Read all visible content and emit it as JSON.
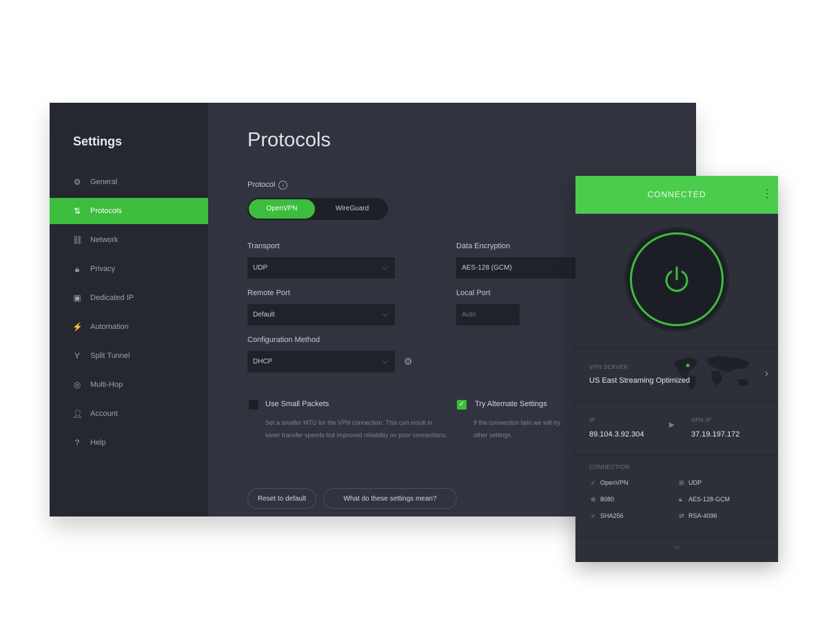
{
  "sidebar": {
    "title": "Settings",
    "items": [
      {
        "label": "General",
        "icon": "settings-icon"
      },
      {
        "label": "Protocols",
        "icon": "protocol-icon",
        "active": true
      },
      {
        "label": "Network",
        "icon": "network-icon"
      },
      {
        "label": "Privacy",
        "icon": "lock-icon"
      },
      {
        "label": "Dedicated IP",
        "icon": "dedicated-ip-icon"
      },
      {
        "label": "Automation",
        "icon": "automation-icon"
      },
      {
        "label": "Split Tunnel",
        "icon": "split-tunnel-icon"
      },
      {
        "label": "Multi-Hop",
        "icon": "multihop-icon"
      },
      {
        "label": "Account",
        "icon": "account-icon"
      },
      {
        "label": "Help",
        "icon": "help-icon"
      }
    ]
  },
  "main": {
    "title": "Protocols",
    "protocol": {
      "label": "Protocol",
      "options": [
        "OpenVPN",
        "WireGuard"
      ],
      "selected": "OpenVPN"
    },
    "transport": {
      "label": "Transport",
      "value": "UDP"
    },
    "data_encryption": {
      "label": "Data Encryption",
      "value": "AES-128 (GCM)"
    },
    "remote_port": {
      "label": "Remote Port",
      "value": "Default"
    },
    "local_port": {
      "label": "Local Port",
      "placeholder": "Auto"
    },
    "configuration_method": {
      "label": "Configuration Method",
      "value": "DHCP"
    },
    "small_packets": {
      "label": "Use Small Packets",
      "checked": false,
      "description": "Set a smaller MTU for the VPN connection. This can result in lower transfer speeds but improved reliability on poor connections."
    },
    "alternate_settings": {
      "label": "Try Alternate Settings",
      "checked": true,
      "description": "If the connection fails we will try other settings."
    },
    "buttons": {
      "reset": "Reset to default",
      "more": "What do these settings mean?"
    }
  },
  "widget": {
    "status": "CONNECTED",
    "location_label": "VPN SERVER",
    "location_name": "US East Streaming Optimized",
    "ip_label": "IP",
    "ip_value": "89.104.3.92.304",
    "vpn_ip_label": "VPN IP",
    "vpn_ip_value": "37.19.197.172",
    "connection_label": "CONNECTION",
    "connection_items": [
      {
        "icon": "protocol-icon",
        "text": "OpenVPN"
      },
      {
        "icon": "transport-icon",
        "text": "UDP"
      },
      {
        "icon": "port-icon",
        "text": "8080"
      },
      {
        "icon": "encryption-icon",
        "text": "AES-128-GCM"
      },
      {
        "icon": "auth-icon",
        "text": "SHA256"
      },
      {
        "icon": "handshake-icon",
        "text": "RSA-4096"
      }
    ],
    "accent": "#4ccc4c"
  },
  "colors": {
    "accent": "#3dbd3d",
    "sidebar_bg": "#262830",
    "content_bg": "#31343f"
  }
}
